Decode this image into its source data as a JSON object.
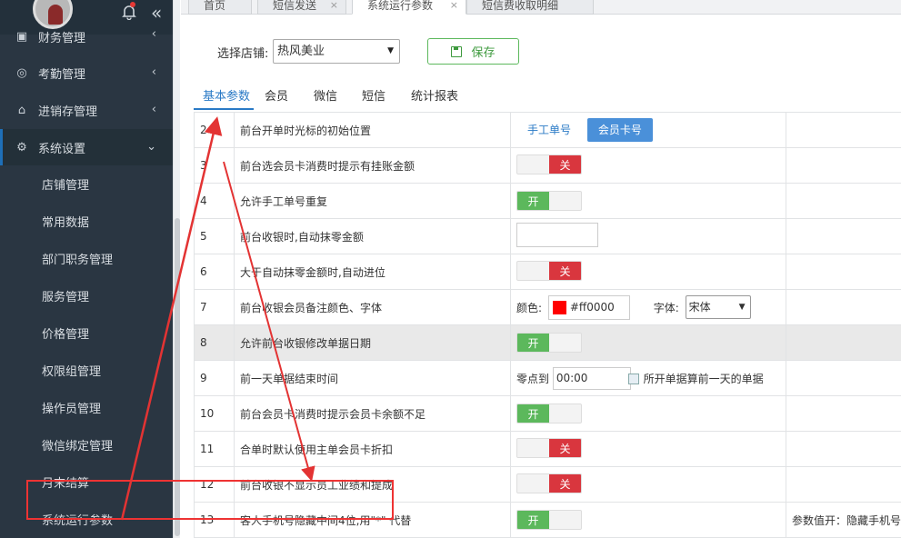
{
  "sidebar": {
    "items": [
      {
        "label": "财务管理",
        "icon": "finance-icon"
      },
      {
        "label": "考勤管理",
        "icon": "fingerprint-icon"
      },
      {
        "label": "进销存管理",
        "icon": "home-icon"
      },
      {
        "label": "系统设置",
        "icon": "gear-icon"
      }
    ],
    "sub_items": [
      "店铺管理",
      "常用数据",
      "部门职务管理",
      "服务管理",
      "价格管理",
      "权限组管理",
      "操作员管理",
      "微信绑定管理",
      "月末结算",
      "系统运行参数"
    ]
  },
  "top_tabs": [
    "首页",
    "短信发送",
    "系统运行参数",
    "短信费收取明细"
  ],
  "store": {
    "label": "选择店铺:",
    "value": "热风美业"
  },
  "save_label": "保存",
  "sub_tabs": [
    "基本参数",
    "会员",
    "微信",
    "短信",
    "统计报表"
  ],
  "rows": [
    {
      "num": "2",
      "name": "前台开单时光标的初始位置",
      "btn1": "手工单号",
      "btn2": "会员卡号"
    },
    {
      "num": "3",
      "name": "前台选会员卡消费时提示有挂账金额",
      "state": "关"
    },
    {
      "num": "4",
      "name": "允许手工单号重复",
      "state": "开"
    },
    {
      "num": "5",
      "name": "前台收银时,自动抹零金额"
    },
    {
      "num": "6",
      "name": "大于自动抹零金额时,自动进位",
      "state": "关"
    },
    {
      "num": "7",
      "name": "前台收银会员备注颜色、字体",
      "color_label": "颜色:",
      "color_value": "#ff0000",
      "font_label": "字体:",
      "font_value": "宋体"
    },
    {
      "num": "8",
      "name": "允许前台收银修改单据日期",
      "state": "开"
    },
    {
      "num": "9",
      "name": "前一天单据结束时间",
      "time_label": "零点到",
      "time_value": "00:00",
      "time_suffix": "所开单据算前一天的单据"
    },
    {
      "num": "10",
      "name": "前台会员卡消费时提示会员卡余额不足",
      "state": "开"
    },
    {
      "num": "11",
      "name": "合单时默认使用主单会员卡折扣",
      "state": "关"
    },
    {
      "num": "12",
      "name": "前台收银不显示员工业绩和提成",
      "state": "关"
    },
    {
      "num": "13",
      "name": "客人手机号隐藏中间4位,用\"*\" 代替",
      "state": "开",
      "note": "参数值开：隐藏手机号"
    }
  ],
  "colors": {
    "sidebar_bg": "#2a3642",
    "accent": "#2a7ac6",
    "on": "#5cb85c",
    "off": "#d9363e",
    "annotation": "#e33333"
  }
}
